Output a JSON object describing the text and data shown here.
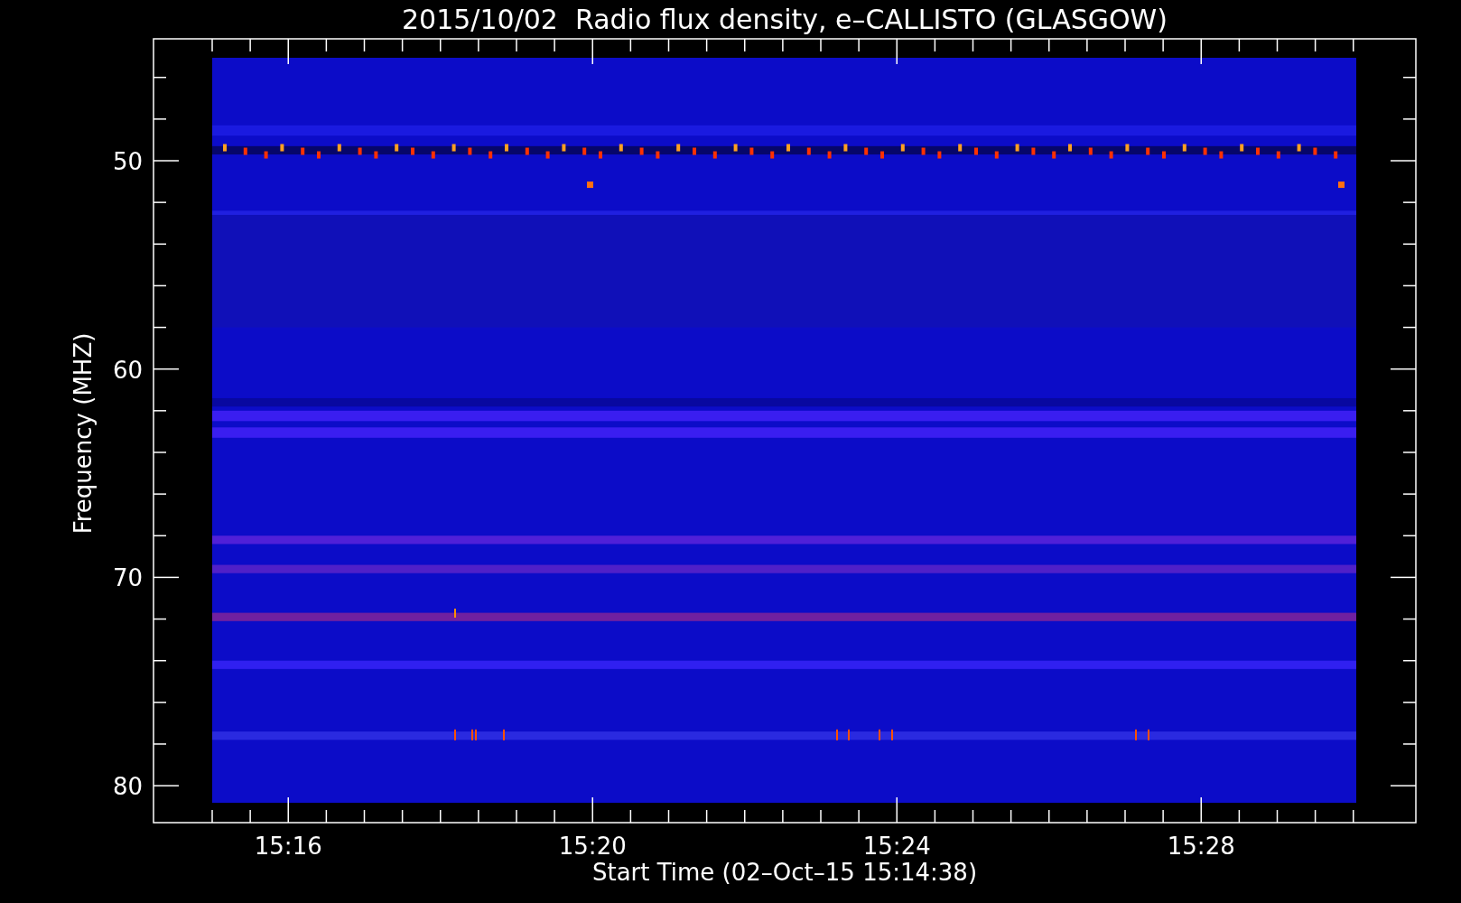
{
  "title": "2015/10/02  Radio flux density, e–CALLISTO (GLASGOW)",
  "ylabel": "Frequency (MHZ)",
  "xlabel": "Start Time (02–Oct–15 15:14:38)",
  "y_tick_labels": [
    "50",
    "60",
    "70",
    "80"
  ],
  "x_tick_labels": [
    "15:16",
    "15:20",
    "15:24",
    "15:28"
  ]
}
